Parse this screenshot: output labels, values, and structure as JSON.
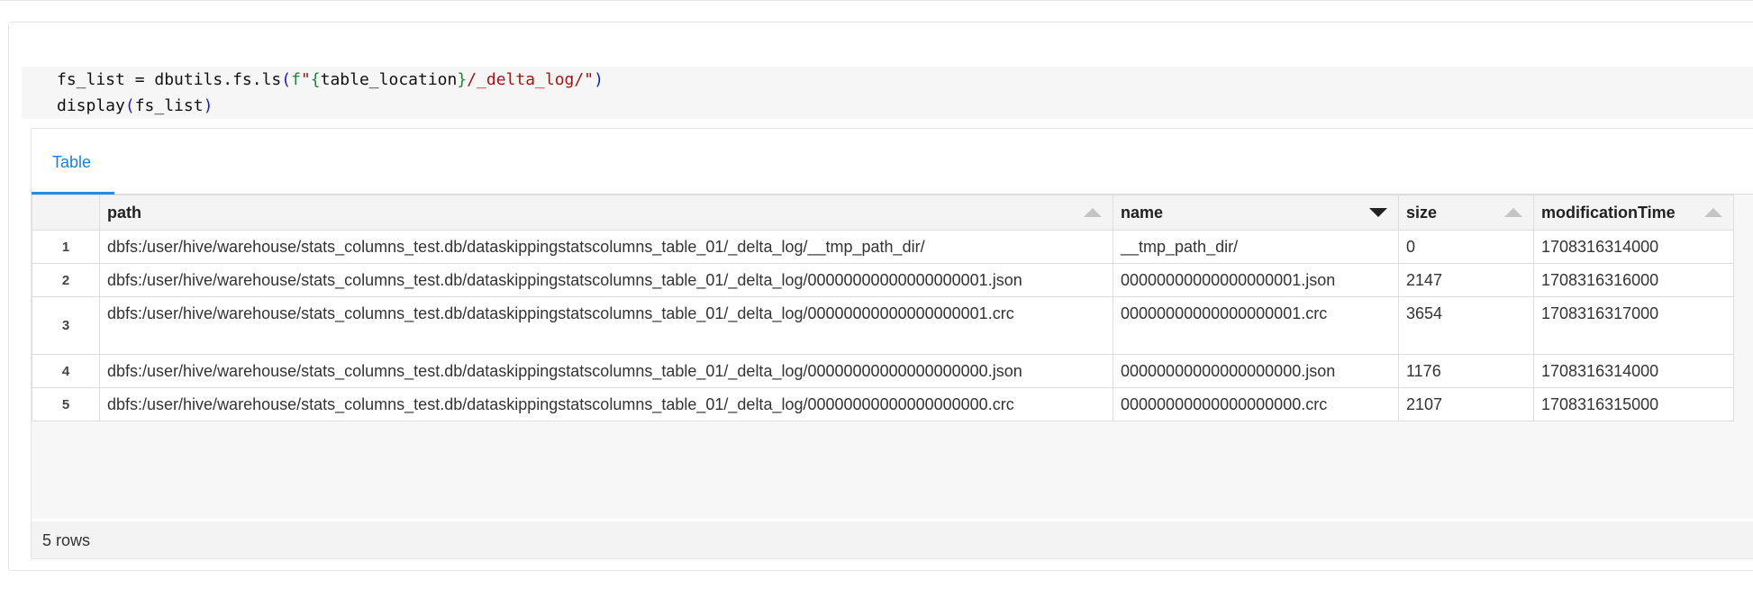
{
  "code": {
    "line1": {
      "prefix": "fs_list = dbutils.fs.ls",
      "open_paren": "(",
      "fpref": "f",
      "str_open": "\"",
      "brace_open": "{",
      "var": "table_location",
      "brace_close": "}",
      "str_rest": "/_delta_log/\"",
      "close_paren": ")"
    },
    "line2": {
      "prefix": "display",
      "open_paren": "(",
      "arg": "fs_list",
      "close_paren": ")"
    }
  },
  "output": {
    "tabs": [
      {
        "label": "Table"
      }
    ],
    "columns": [
      {
        "label": "path",
        "sort": "asc"
      },
      {
        "label": "name",
        "sort": "desc"
      },
      {
        "label": "size",
        "sort": "asc"
      },
      {
        "label": "modificationTime",
        "sort": "asc"
      }
    ],
    "rows": [
      {
        "num": "1",
        "path": "dbfs:/user/hive/warehouse/stats_columns_test.db/dataskippingstatscolumns_table_01/_delta_log/__tmp_path_dir/",
        "name": "__tmp_path_dir/",
        "size": "0",
        "modificationTime": "1708316314000"
      },
      {
        "num": "2",
        "path": "dbfs:/user/hive/warehouse/stats_columns_test.db/dataskippingstatscolumns_table_01/_delta_log/00000000000000000001.json",
        "name": "00000000000000000001.json",
        "size": "2147",
        "modificationTime": "1708316316000"
      },
      {
        "num": "3",
        "path": "dbfs:/user/hive/warehouse/stats_columns_test.db/dataskippingstatscolumns_table_01/_delta_log/00000000000000000001.crc",
        "name": "00000000000000000001.crc",
        "size": "3654",
        "modificationTime": "1708316317000"
      },
      {
        "num": "4",
        "path": "dbfs:/user/hive/warehouse/stats_columns_test.db/dataskippingstatscolumns_table_01/_delta_log/00000000000000000000.json",
        "name": "00000000000000000000.json",
        "size": "1176",
        "modificationTime": "1708316314000"
      },
      {
        "num": "5",
        "path": "dbfs:/user/hive/warehouse/stats_columns_test.db/dataskippingstatscolumns_table_01/_delta_log/00000000000000000000.crc",
        "name": "00000000000000000000.crc",
        "size": "2107",
        "modificationTime": "1708316315000"
      }
    ],
    "footer": {
      "row_count": "5 rows"
    }
  },
  "colors": {
    "accent": "#2a8ce0",
    "code_string": "#a31515",
    "code_paren": "#1a1acb"
  }
}
